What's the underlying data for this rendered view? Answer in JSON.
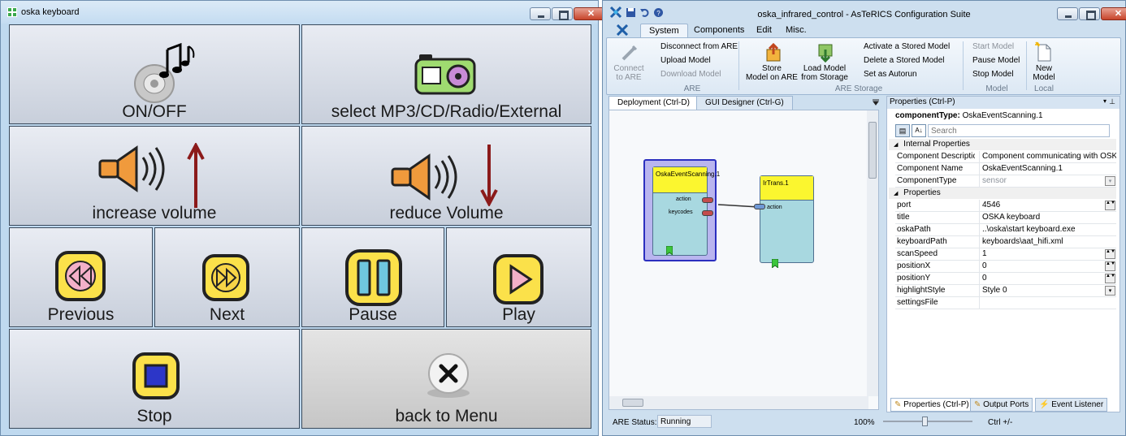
{
  "oska": {
    "title": "oska keyboard",
    "keys": {
      "on_off": "ON/OFF",
      "select": "select MP3/CD/Radio/External",
      "increase": "increase volume",
      "reduce": "reduce Volume",
      "previous": "Previous",
      "next": "Next",
      "pause": "Pause",
      "play": "Play",
      "stop": "Stop",
      "back": "back to Menu"
    }
  },
  "acs": {
    "title": "oska_infrared_control - AsTeRICS Configuration Suite",
    "tabs": [
      "System",
      "Components",
      "Edit",
      "Misc."
    ],
    "ribbon": {
      "connect": "Connect\nto ARE",
      "disconnect": "Disconnect from ARE",
      "upload": "Upload Model",
      "download": "Download Model",
      "are_group": "ARE",
      "store_are": "Store\nModel on ARE",
      "load_storage": "Load Model\nfrom Storage",
      "activate": "Activate a Stored Model",
      "delete": "Delete a Stored Model",
      "autorun": "Set as Autorun",
      "storage_group": "ARE Storage",
      "start": "Start Model",
      "pause": "Pause Model",
      "stop": "Stop Model",
      "model_group": "Model",
      "new_model": "New\nModel",
      "local_group": "Local"
    },
    "doc_tabs": [
      "Deployment (Ctrl-D)",
      "GUI Designer (Ctrl-G)"
    ],
    "components": {
      "oska_event": "OskaEventScanning.1",
      "irtrans": "IrTrans.1",
      "port_action_out": "action",
      "port_keycodes": "keycodes",
      "port_action_in": "action"
    },
    "status": {
      "label": "ARE Status:",
      "value": "Running",
      "zoom": "100%",
      "zoom_hint": "Ctrl +/-"
    },
    "properties": {
      "header": "Properties (Ctrl-P)",
      "component_type_label": "componentType:",
      "component_type_value": "OskaEventScanning.1",
      "search_placeholder": "Search",
      "internal_cat": "Internal Properties",
      "props_cat": "Properties",
      "internal_rows": [
        {
          "k": "Component Descriptic",
          "v": "Component communicating with OSKA"
        },
        {
          "k": "Component Name",
          "v": "OskaEventScanning.1"
        },
        {
          "k": "ComponentType",
          "v": "sensor"
        }
      ],
      "rows": [
        {
          "k": "port",
          "v": "4546"
        },
        {
          "k": "title",
          "v": "OSKA keyboard"
        },
        {
          "k": "oskaPath",
          "v": "..\\oska\\start keyboard.exe"
        },
        {
          "k": "keyboardPath",
          "v": "keyboards\\aat_hifi.xml"
        },
        {
          "k": "scanSpeed",
          "v": "1"
        },
        {
          "k": "positionX",
          "v": "0"
        },
        {
          "k": "positionY",
          "v": "0"
        },
        {
          "k": "highlightStyle",
          "v": "Style 0"
        },
        {
          "k": "settingsFile",
          "v": ""
        }
      ]
    },
    "bottom_tabs": [
      "Properties (Ctrl-P)",
      "Output Ports",
      "Event Listener"
    ]
  }
}
